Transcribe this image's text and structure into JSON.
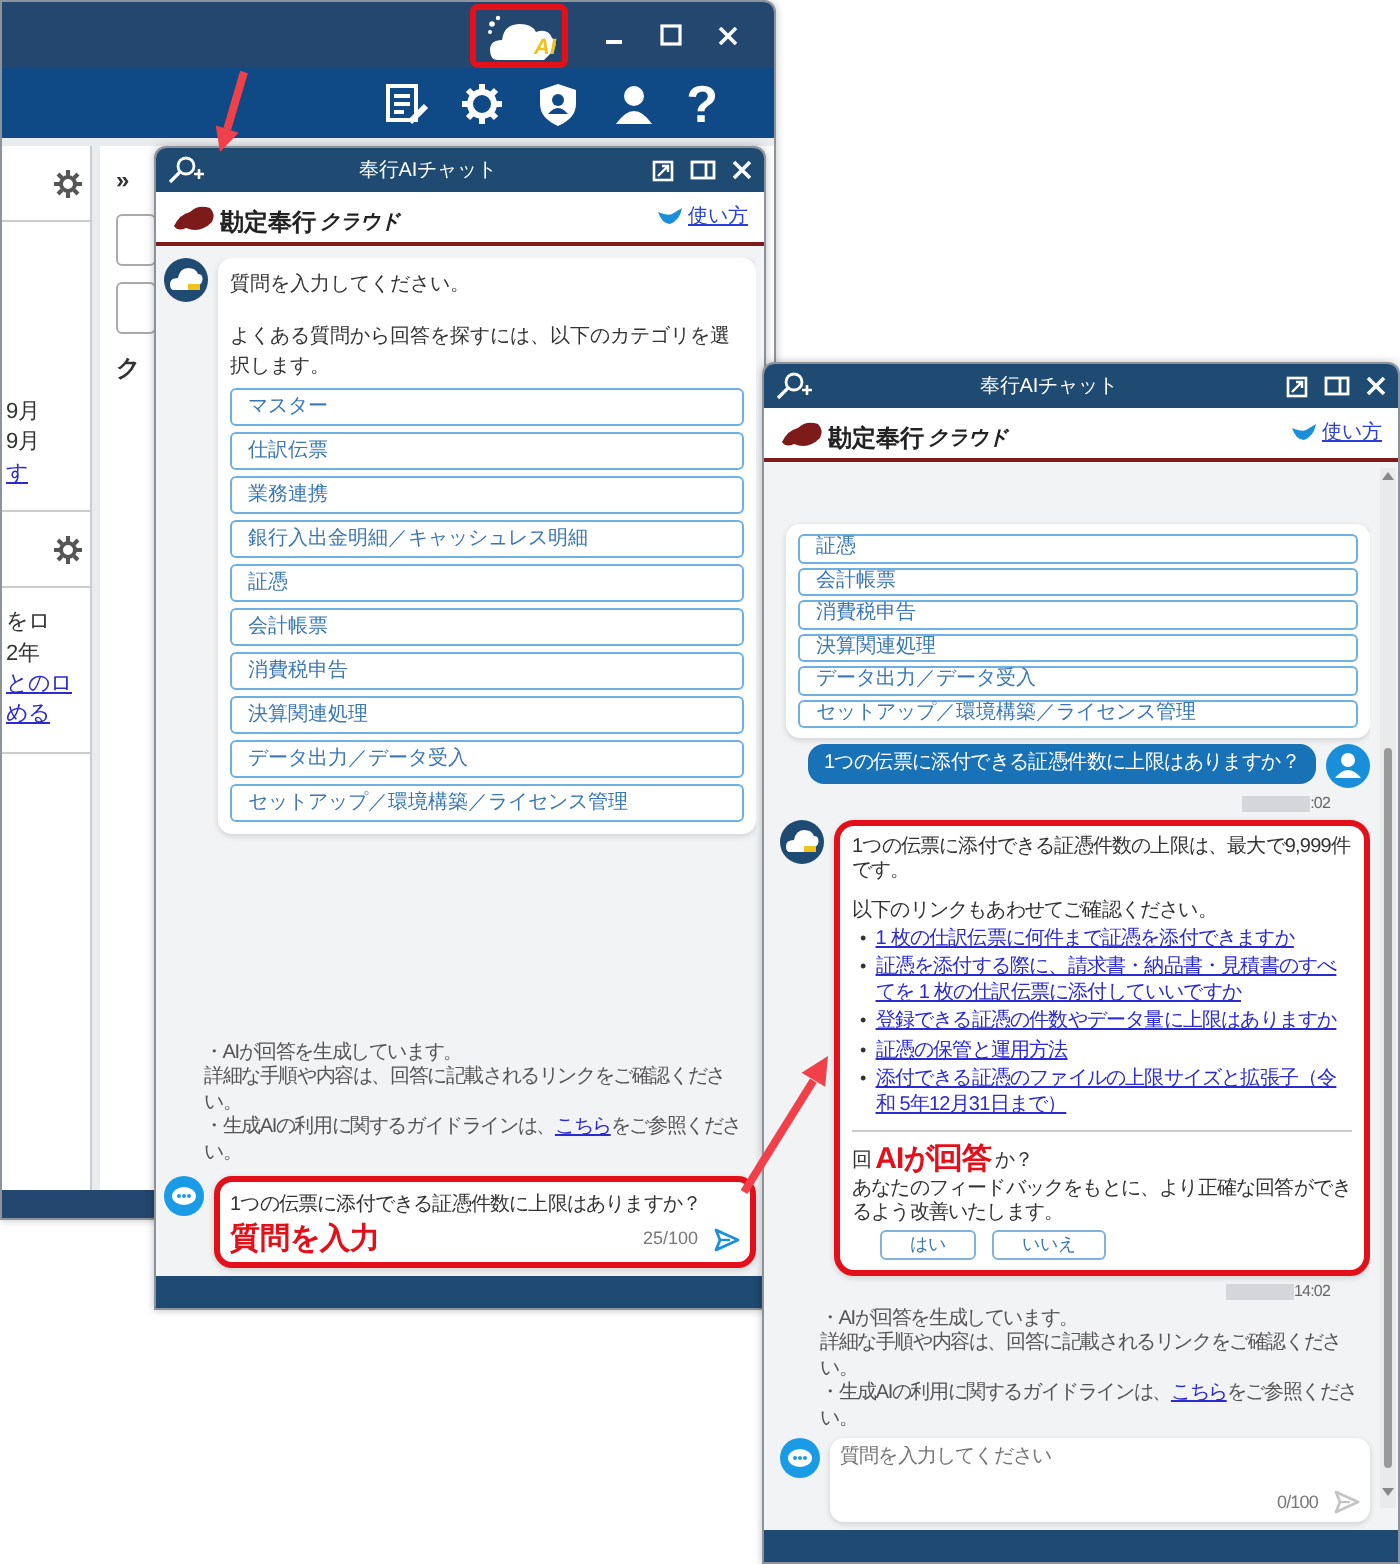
{
  "back_window": {
    "ai_badge": "AI",
    "ai_highlighted": true,
    "help_glyph": "?",
    "panels": [
      {
        "lines": [
          {
            "text": "9月",
            "link": false
          },
          {
            "text": "9月",
            "link": false
          },
          {
            "text": "す",
            "link": true
          }
        ]
      },
      {
        "lines": [
          {
            "text": "をロ",
            "link": false
          },
          {
            "text": "2年",
            "link": false
          },
          {
            "text": "とのロ",
            "link": true
          },
          {
            "text": "める",
            "link": true
          }
        ]
      }
    ],
    "side_texts": [
      "»",
      "ク"
    ]
  },
  "chat_windows": [
    {
      "title": "奉行AIチャット",
      "logo_main": "勘定奉行",
      "logo_sub": "クラウド",
      "help_link": "使い方",
      "messages": [
        {
          "kind": "bot_categories",
          "lines": [
            "質問を入力してください。",
            "よくある質問から回答を探すには、以下のカテゴリを選択します。"
          ],
          "categories": [
            "マスター",
            "仕訳伝票",
            "業務連携",
            "銀行入出金明細／キャッシュレス明細",
            "証憑",
            "会計帳票",
            "消費税申告",
            "決算関連処理",
            "データ出力／データ受入",
            "セットアップ／環境構築／ライセンス管理"
          ]
        }
      ],
      "notes": [
        {
          "text": "・AIが回答を生成しています。"
        },
        {
          "text": "詳細な手順や内容は、回答に記載されるリンクをご確認ください。"
        },
        {
          "text": "・生成AIの利用に関するガイドラインは、",
          "link": "こちら",
          "after": "をご参照ください。"
        }
      ],
      "input": {
        "value": "1つの伝票に添付できる証憑件数に上限はありますか？",
        "counter": "25/100",
        "send_enabled": true,
        "highlighted": true,
        "callout": "質問を入力"
      }
    },
    {
      "title": "奉行AIチャット",
      "logo_main": "勘定奉行",
      "logo_sub": "クラウド",
      "help_link": "使い方",
      "messages": [
        {
          "kind": "bot_categories",
          "categories": [
            "証憑",
            "会計帳票",
            "消費税申告",
            "決算関連処理",
            "データ出力／データ受入",
            "セットアップ／環境構築／ライセンス管理"
          ]
        },
        {
          "kind": "user",
          "text": "1つの伝票に添付できる証憑件数に上限はありますか？",
          "time": ":02"
        },
        {
          "kind": "bot_answer",
          "highlighted": true,
          "bullet": "•",
          "text": "1つの伝票に添付できる証憑件数の上限は、最大で9,999件です。",
          "intro": "以下のリンクもあわせてご確認ください。",
          "links": [
            "1 枚の仕訳伝票に何件まで証憑を添付できますか",
            "証憑を添付する際に、請求書・納品書・見積書のすべてを 1 枚の仕訳伝票に添付していいですか",
            "登録できる証憑の件数やデータ量に上限はありますか",
            "証憑の保管と運用方法",
            "添付できる証憑のファイルの上限サイズと拡張子（令和 5年12月31日まで）"
          ],
          "feedback_before": "回",
          "callout": "AIが回答",
          "feedback_after": "か？",
          "feedback_note": "あなたのフィードバックをもとに、より正確な回答ができるよう改善いたします。",
          "buttons": [
            "はい",
            "いいえ"
          ],
          "time": "14:02"
        }
      ],
      "notes": [
        {
          "text": "・AIが回答を生成しています。"
        },
        {
          "text": "詳細な手順や内容は、回答に記載されるリンクをご確認ください。"
        },
        {
          "text": "・生成AIの利用に関するガイドラインは、",
          "link": "こちら",
          "after": "をご参照ください。"
        }
      ],
      "input": {
        "placeholder": "質問を入力してください",
        "counter": "0/100",
        "send_enabled": false,
        "highlighted": false
      }
    }
  ]
}
